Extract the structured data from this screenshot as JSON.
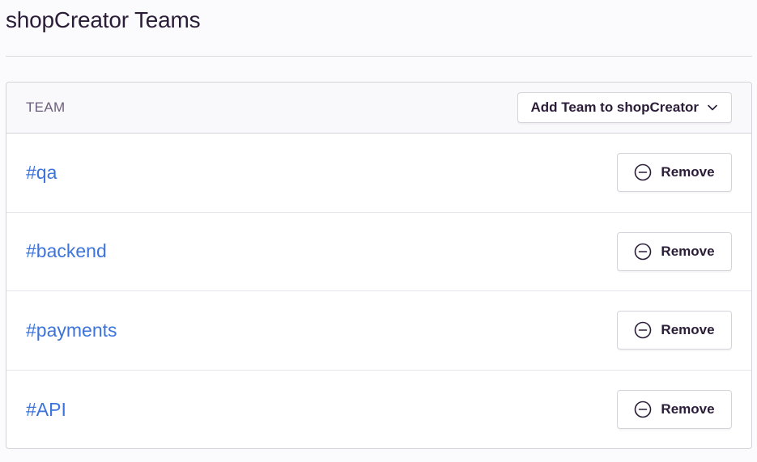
{
  "page": {
    "title": "shopCreator Teams"
  },
  "panel": {
    "header_label": "TEAM",
    "add_button_label": "Add Team to shopCreator",
    "add_button_icon": "chevron-down-icon"
  },
  "teams": [
    {
      "name": "#qa",
      "remove_label": "Remove",
      "remove_icon": "minus-circle-icon"
    },
    {
      "name": "#backend",
      "remove_label": "Remove",
      "remove_icon": "minus-circle-icon"
    },
    {
      "name": "#payments",
      "remove_label": "Remove",
      "remove_icon": "minus-circle-icon"
    },
    {
      "name": "#API",
      "remove_label": "Remove",
      "remove_icon": "minus-circle-icon"
    }
  ],
  "colors": {
    "link": "#3d74db",
    "text": "#2b1d38",
    "muted": "#6c5f7b",
    "border": "#d6d2db"
  }
}
